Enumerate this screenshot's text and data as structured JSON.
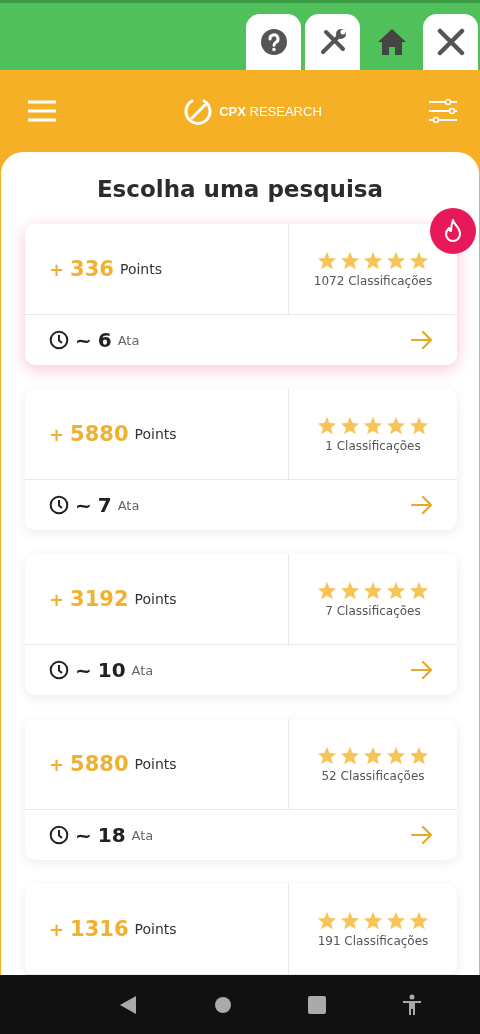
{
  "top_tabs": [
    {
      "kind": "help",
      "selected": false
    },
    {
      "kind": "tools",
      "selected": false
    },
    {
      "kind": "home",
      "selected": true
    },
    {
      "kind": "close",
      "selected": false
    }
  ],
  "header": {
    "logo": "**CPX** RESEARCH"
  },
  "title": "Escolha uma pesquisa",
  "surveys": [
    {
      "hot": true,
      "plus": "+",
      "points": "336",
      "points_label": "Points",
      "stars": 5,
      "ratings": "1072 Classificações",
      "tilde": "~",
      "minutes": "6",
      "minutes_label": "Ata"
    },
    {
      "hot": false,
      "plus": "+",
      "points": "5880",
      "points_label": "Points",
      "stars": 5,
      "ratings": "1 Classificações",
      "tilde": "~",
      "minutes": "7",
      "minutes_label": "Ata"
    },
    {
      "hot": false,
      "plus": "+",
      "points": "3192",
      "points_label": "Points",
      "stars": 5,
      "ratings": "7 Classificações",
      "tilde": "~",
      "minutes": "10",
      "minutes_label": "Ata"
    },
    {
      "hot": false,
      "plus": "+",
      "points": "5880",
      "points_label": "Points",
      "stars": 5,
      "ratings": "52 Classificações",
      "tilde": "~",
      "minutes": "18",
      "minutes_label": "Ata"
    },
    {
      "hot": false,
      "plus": "+",
      "points": "1316",
      "points_label": "Points",
      "stars": 5,
      "ratings": "191 Classificações"
    }
  ]
}
